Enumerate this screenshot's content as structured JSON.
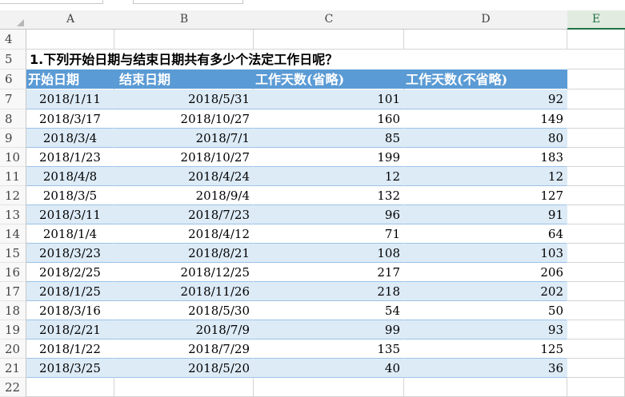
{
  "columns": [
    "A",
    "B",
    "C",
    "D",
    "E"
  ],
  "selected_column": "E",
  "row_numbers": [
    "4",
    "5",
    "6",
    "7",
    "8",
    "9",
    "10",
    "11",
    "12",
    "13",
    "14",
    "15",
    "16",
    "17",
    "18",
    "19",
    "20",
    "21",
    "22"
  ],
  "question": "1.下列开始日期与结束日期共有多少个法定工作日呢？",
  "table_headers": [
    "开始日期",
    "结束日期",
    "工作天数(省略)",
    "工作天数(不省略)"
  ],
  "rows": [
    [
      "2018/1/11",
      "2018/5/31",
      "101",
      "92"
    ],
    [
      "2018/3/17",
      "2018/10/27",
      "160",
      "149"
    ],
    [
      "2018/3/4",
      "2018/7/1",
      "85",
      "80"
    ],
    [
      "2018/1/23",
      "2018/10/27",
      "199",
      "183"
    ],
    [
      "2018/4/8",
      "2018/4/24",
      "12",
      "12"
    ],
    [
      "2018/3/5",
      "2018/9/4",
      "132",
      "127"
    ],
    [
      "2018/3/11",
      "2018/7/23",
      "96",
      "91"
    ],
    [
      "2018/1/4",
      "2018/4/12",
      "71",
      "64"
    ],
    [
      "2018/3/23",
      "2018/8/21",
      "108",
      "103"
    ],
    [
      "2018/2/25",
      "2018/12/25",
      "217",
      "206"
    ],
    [
      "2018/1/25",
      "2018/11/26",
      "218",
      "202"
    ],
    [
      "2018/3/16",
      "2018/5/30",
      "54",
      "50"
    ],
    [
      "2018/2/21",
      "2018/7/9",
      "99",
      "93"
    ],
    [
      "2018/1/22",
      "2018/7/29",
      "135",
      "125"
    ],
    [
      "2018/3/25",
      "2018/5/20",
      "40",
      "36"
    ]
  ],
  "colors": {
    "header_fill": "#5b9bd5",
    "band_fill": "#ddebf7",
    "selected_col_accent": "#217346"
  }
}
